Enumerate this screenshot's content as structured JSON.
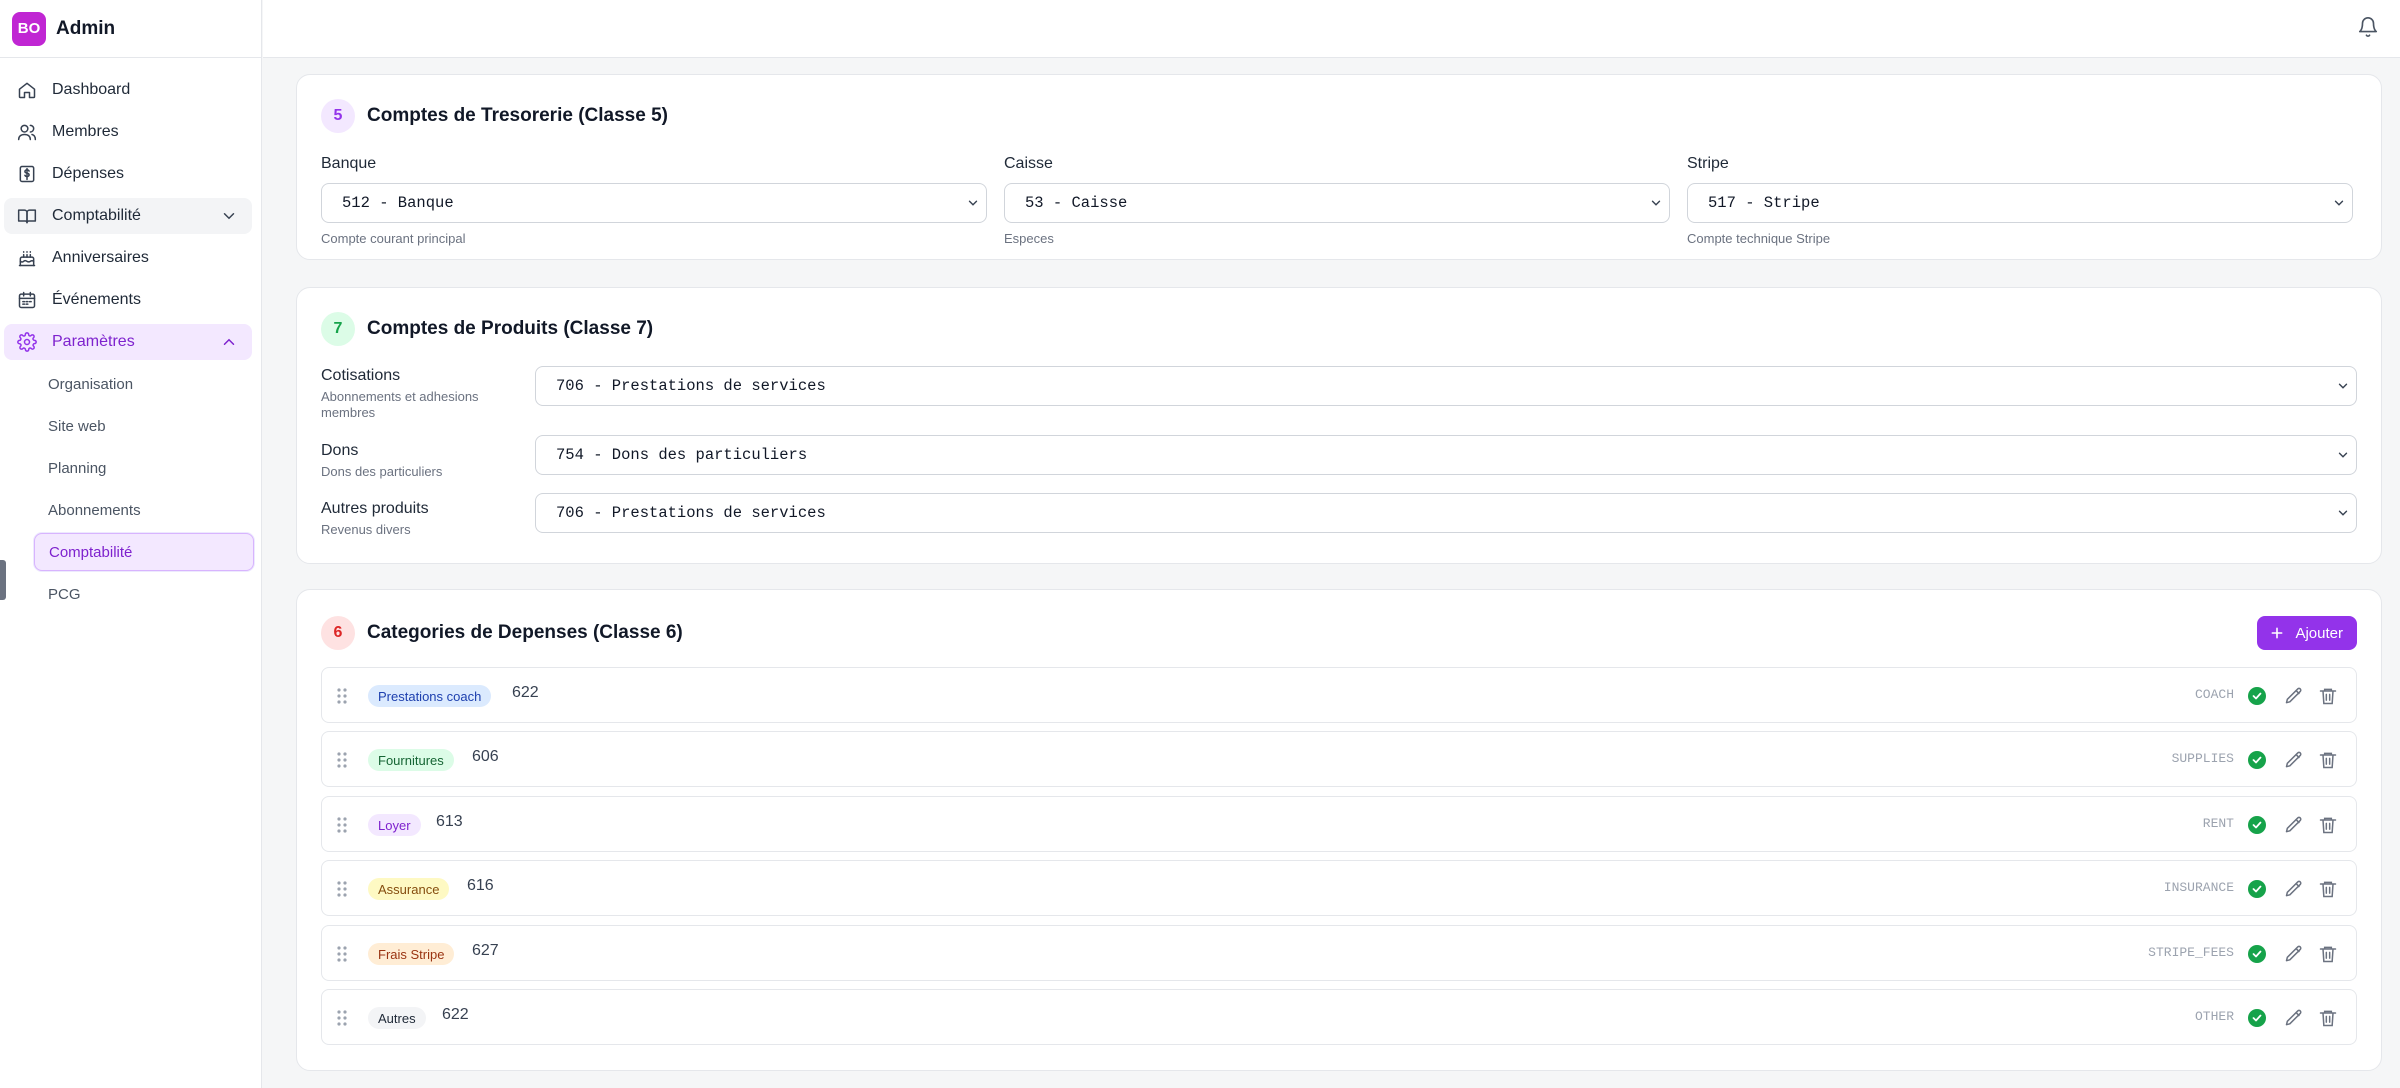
{
  "brand": {
    "logo": "BO",
    "name": "Admin"
  },
  "sidebar": {
    "items": [
      {
        "label": "Dashboard",
        "icon": "home-icon"
      },
      {
        "label": "Membres",
        "icon": "users-icon"
      },
      {
        "label": "Dépenses",
        "icon": "dollar-receipt-icon"
      },
      {
        "label": "Comptabilité",
        "icon": "book-icon"
      },
      {
        "label": "Anniversaires",
        "icon": "cake-icon"
      },
      {
        "label": "Événements",
        "icon": "calendar-icon"
      },
      {
        "label": "Paramètres",
        "icon": "gear-icon"
      }
    ],
    "sub_items": [
      {
        "label": "Organisation"
      },
      {
        "label": "Site web"
      },
      {
        "label": "Planning"
      },
      {
        "label": "Abonnements"
      },
      {
        "label": "Comptabilité"
      },
      {
        "label": "PCG"
      }
    ]
  },
  "treasury": {
    "badge": "5",
    "title": "Comptes de Tresorerie (Classe 5)",
    "fields": [
      {
        "label": "Banque",
        "value": "512 - Banque",
        "hint": "Compte courant principal"
      },
      {
        "label": "Caisse",
        "value": "53 - Caisse",
        "hint": "Especes"
      },
      {
        "label": "Stripe",
        "value": "517 - Stripe",
        "hint": "Compte technique Stripe"
      }
    ]
  },
  "products": {
    "badge": "7",
    "title": "Comptes de Produits (Classe 7)",
    "rows": [
      {
        "label": "Cotisations",
        "hint": "Abonnements et adhesions membres",
        "value": "706 - Prestations de services"
      },
      {
        "label": "Dons",
        "hint": "Dons des particuliers",
        "value": "754 - Dons des particuliers"
      },
      {
        "label": "Autres produits",
        "hint": "Revenus divers",
        "value": "706 - Prestations de services"
      }
    ]
  },
  "expenses": {
    "badge": "6",
    "title": "Categories de Depenses (Classe 6)",
    "add_label": "Ajouter",
    "rows": [
      {
        "tag": "Prestations coach",
        "code": "622",
        "ident": "COACH",
        "tag_bg": "#dbeafe",
        "tag_fg": "#1e40af"
      },
      {
        "tag": "Fournitures",
        "code": "606",
        "ident": "SUPPLIES",
        "tag_bg": "#dcfce7",
        "tag_fg": "#166534"
      },
      {
        "tag": "Loyer",
        "code": "613",
        "ident": "RENT",
        "tag_bg": "#f3e8ff",
        "tag_fg": "#7e22ce"
      },
      {
        "tag": "Assurance",
        "code": "616",
        "ident": "INSURANCE",
        "tag_bg": "#fef9c3",
        "tag_fg": "#854d0e"
      },
      {
        "tag": "Frais Stripe",
        "code": "627",
        "ident": "STRIPE_FEES",
        "tag_bg": "#ffedd5",
        "tag_fg": "#9a3412"
      },
      {
        "tag": "Autres",
        "code": "622",
        "ident": "OTHER",
        "tag_bg": "#f3f4f6",
        "tag_fg": "#1f2937"
      }
    ]
  },
  "colors": {
    "accent": "#9333ea",
    "badge5_bg": "#f3e8ff",
    "badge5_fg": "#9333ea",
    "badge7_bg": "#dcfce7",
    "badge7_fg": "#16a34a",
    "badge6_bg": "#fee2e2",
    "badge6_fg": "#dc2626",
    "success": "#16a34a"
  }
}
